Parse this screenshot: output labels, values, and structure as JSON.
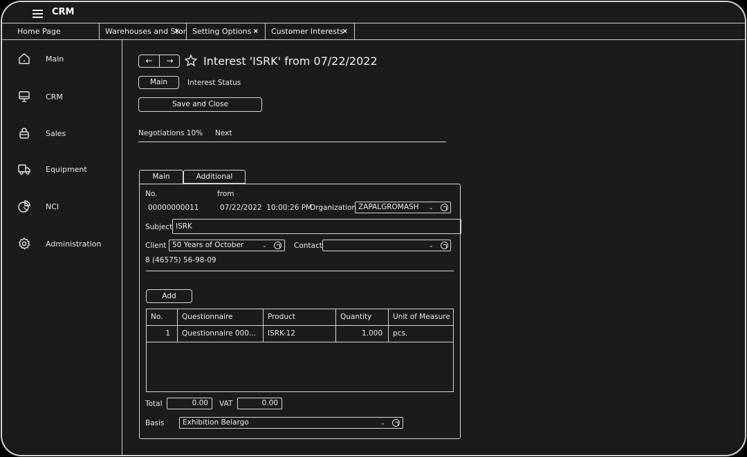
{
  "app": {
    "title": "CRM"
  },
  "tabs": [
    {
      "label": "Home Page",
      "closable": false
    },
    {
      "label": "Warehouses and Stores",
      "closable": true
    },
    {
      "label": "Setting Options",
      "closable": true
    },
    {
      "label": "Customer Interests",
      "closable": true
    }
  ],
  "tab_close_glyph": "×",
  "sidebar": {
    "items": [
      {
        "label": "Main",
        "icon": "home-icon"
      },
      {
        "label": "CRM",
        "icon": "monitor-icon"
      },
      {
        "label": "Sales",
        "icon": "shopping-bag-icon"
      },
      {
        "label": "Equipment",
        "icon": "truck-icon"
      },
      {
        "label": "NCI",
        "icon": "pie-chart-icon"
      },
      {
        "label": "Administration",
        "icon": "gear-icon"
      }
    ]
  },
  "header": {
    "back_glyph": "←",
    "forward_glyph": "→",
    "title": "Interest 'ISRK' from 07/22/2022"
  },
  "subnav": {
    "main_label": "Main",
    "status_label": "Interest Status"
  },
  "save_close_label": "Save and Close",
  "stage": {
    "label": "Negotiations 10%",
    "next_label": "Next"
  },
  "form_tabs": {
    "main": "Main",
    "additional": "Additional"
  },
  "form": {
    "no_label": "No.",
    "from_label": "from",
    "number": "00000000011",
    "date": "07/22/2022  10:00:26 PM",
    "organization_label": "Organization",
    "organization_value": "ZAPALGROMASH",
    "subject_label": "Subject",
    "subject_value": "ISRK",
    "client_label": "Client",
    "client_value": "50 Years of October",
    "contact_label": "Contact",
    "contact_value": "",
    "phone": "8 (46575) 56-98-09",
    "add_label": "Add",
    "total_label": "Total",
    "total_value": "0.00",
    "vat_label": "VAT",
    "vat_value": "0.00",
    "basis_label": "Basis",
    "basis_value": "Exhibition Belargo"
  },
  "chevron_glyph": "⌄",
  "table": {
    "headers": [
      "No.",
      "Questionnaire",
      "Product",
      "Quantity",
      "Unit of Measure"
    ],
    "rows": [
      [
        "1",
        "Questionnaire 000...",
        "ISRK-12",
        "1.000",
        "pcs."
      ]
    ]
  }
}
